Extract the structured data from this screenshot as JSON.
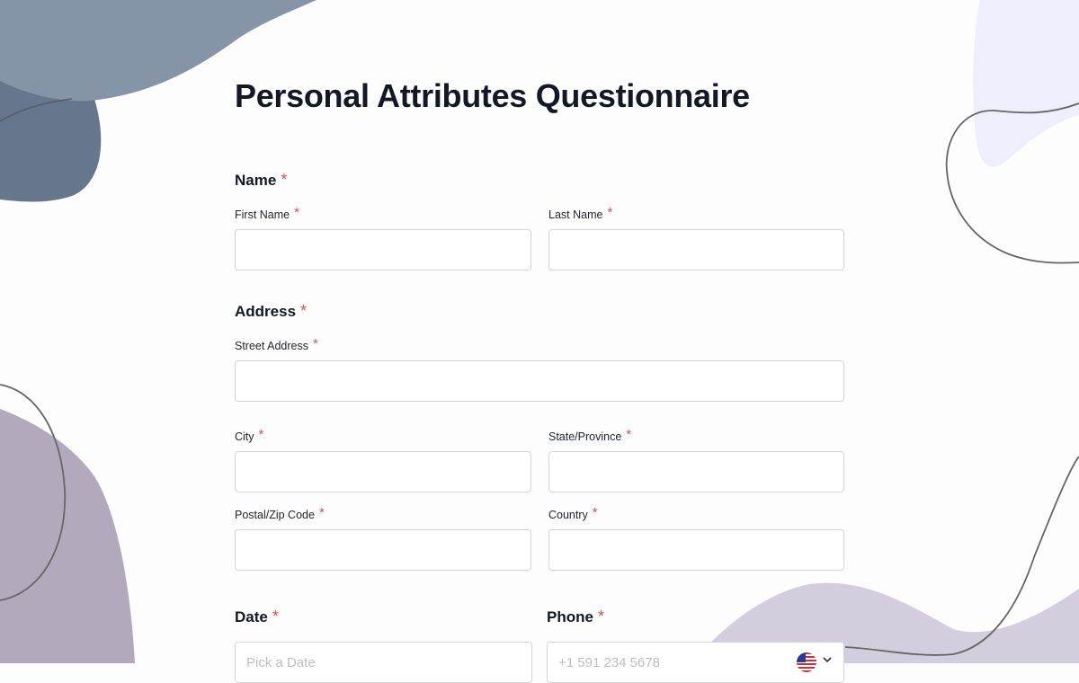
{
  "form": {
    "title": "Personal Attributes Questionnaire",
    "required_mark": "*",
    "sections": {
      "name": "Name",
      "address": "Address",
      "date": "Date",
      "phone": "Phone"
    },
    "labels": {
      "first_name": "First Name",
      "last_name": "Last Name",
      "street": "Street Address",
      "city": "City",
      "state": "State/Province",
      "postal": "Postal/Zip Code",
      "country": "Country"
    },
    "placeholders": {
      "date": "Pick a Date",
      "phone": "+1 591 234 5678"
    },
    "phone_country_icon": "us-flag-icon",
    "colors": {
      "required": "#e24c4c",
      "title": "#141824",
      "input_border": "#d3d5db"
    }
  }
}
